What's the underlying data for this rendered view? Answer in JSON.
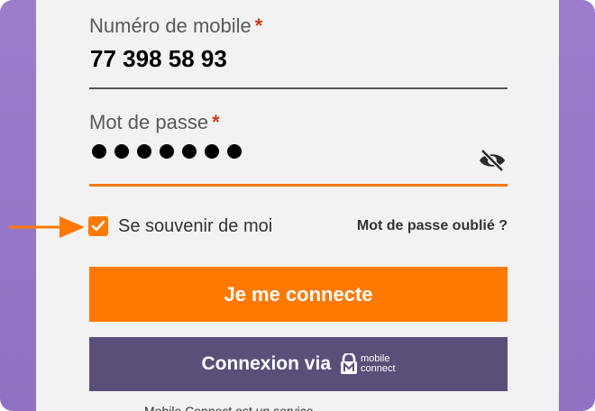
{
  "mobile": {
    "label": "Numéro de mobile",
    "required_mark": "*",
    "value": "77 398 58 93"
  },
  "password": {
    "label": "Mot de passe",
    "required_mark": "*",
    "masked_length": 7,
    "toggle_icon": "eye-slash-icon"
  },
  "remember": {
    "label": "Se souvenir de moi",
    "checked": true
  },
  "forgot_link": "Mot de passe oublié ?",
  "login_button": "Je me connecte",
  "mobile_connect_button": {
    "label": "Connexion via",
    "logo_line1": "mobile",
    "logo_line2": "connect"
  },
  "footer_text_partial": "Mobile Connect est un service ...",
  "colors": {
    "accent": "#ff7900",
    "secondary": "#5b4f7a",
    "required": "#cd3c14",
    "background": "#9a7ccb"
  }
}
